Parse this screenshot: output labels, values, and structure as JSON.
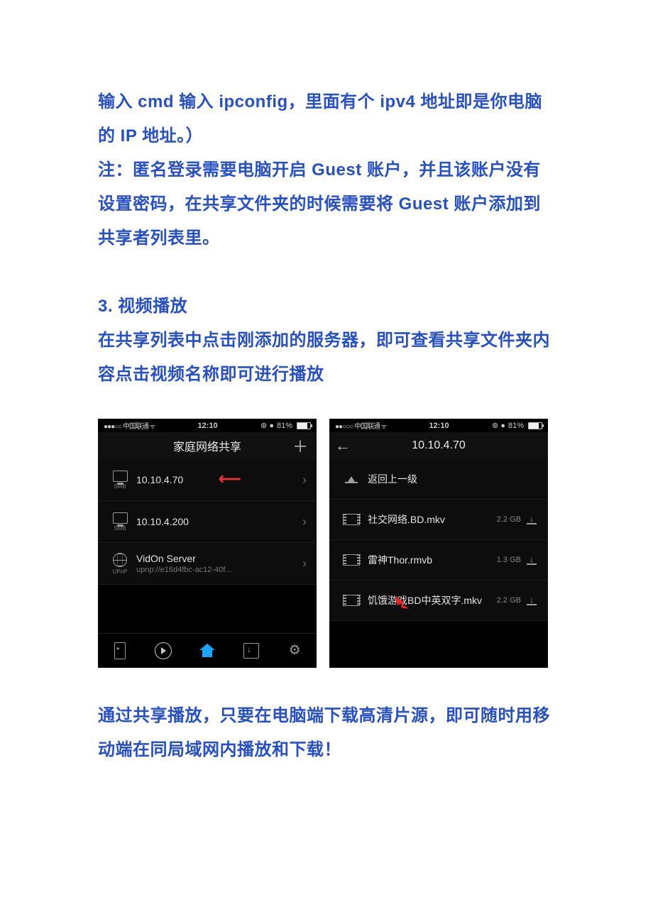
{
  "para1": "输入 cmd 输入 ipconfig，里面有个 ipv4 地址即是你电脑的 IP 地址。）",
  "para2": "注：匿名登录需要电脑开启 Guest 账户，并且该账户没有设置密码，在共享文件夹的时候需要将 Guest 账户添加到共享者列表里。",
  "sect3_title": "3. 视频播放",
  "sect3_body": "在共享列表中点击刚添加的服务器，即可查看共享文件夹内容点击视频名称即可进行播放",
  "para3": "通过共享播放，只要在电脑端下载高清片源，即可随时用移动端在同局域网内播放和下载！",
  "shot_left": {
    "status_carrier": "●●●○○ 中国联通",
    "status_time": "12:10",
    "status_batt": "81%",
    "title": "家庭网络共享",
    "add": "＋",
    "rows": [
      {
        "icon": "smb",
        "icon_label": "SMB",
        "main": "10.10.4.70",
        "sub": ""
      },
      {
        "icon": "smb",
        "icon_label": "SMB",
        "main": "10.10.4.200",
        "sub": ""
      },
      {
        "icon": "upnp",
        "icon_label": "UPnP",
        "main": "VidOn Server",
        "sub": "upnp://e16d4fbc-ac12-40f..."
      }
    ]
  },
  "shot_right": {
    "status_carrier": "●●○○○ 中国联通",
    "status_time": "12:10",
    "status_batt": "81%",
    "title": "10.10.4.70",
    "back": "←",
    "rows": [
      {
        "icon": "up",
        "main": "返回上一级",
        "size": ""
      },
      {
        "icon": "film",
        "main": "社交网络.BD.mkv",
        "size": "2.2 GB"
      },
      {
        "icon": "film",
        "main": "雷神Thor.rmvb",
        "size": "1.3 GB"
      },
      {
        "icon": "film",
        "main": "饥饿游戏BD中英双字.mkv",
        "size": "2.2 GB"
      }
    ]
  }
}
